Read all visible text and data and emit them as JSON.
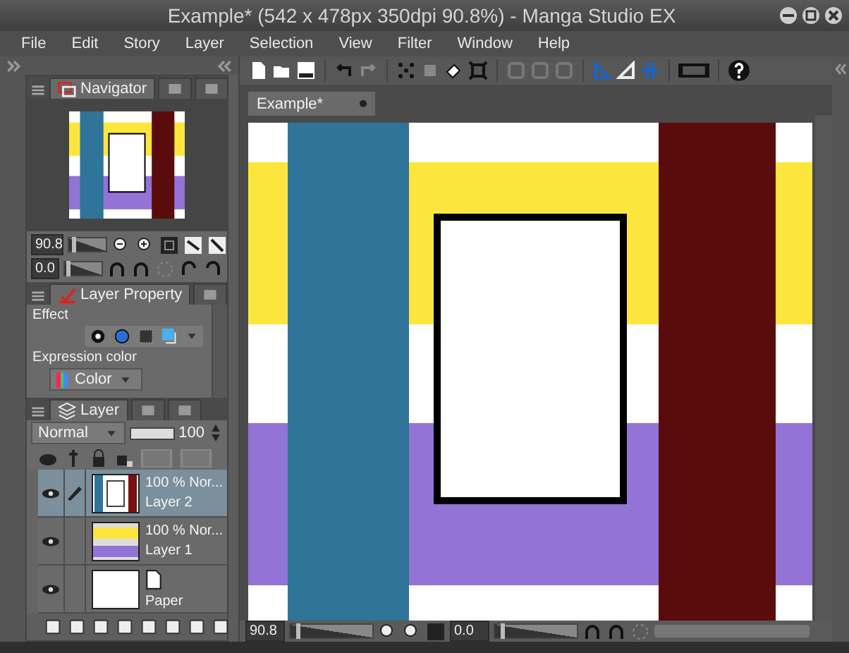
{
  "window": {
    "title": "Example* (542 x 478px 350dpi 90.8%) - Manga Studio EX"
  },
  "menu": [
    "File",
    "Edit",
    "Story",
    "Layer",
    "Selection",
    "View",
    "Filter",
    "Window",
    "Help"
  ],
  "navigator": {
    "tabs": [
      {
        "kind": "text",
        "label": "Navigator",
        "selected": true
      },
      {
        "kind": "icon",
        "selected": false
      },
      {
        "kind": "icon",
        "selected": false
      }
    ],
    "zoom": "90.8",
    "zoom_slider": {
      "level": 0.1
    },
    "angle": "0.0",
    "angle_slider": {
      "level": 0.1
    }
  },
  "layer_property": {
    "tabs": [
      {
        "kind": "text",
        "label": "Layer Property",
        "selected": true
      },
      {
        "kind": "icon",
        "selected": false
      }
    ],
    "effect_label": "Effect",
    "expression_label": "Expression color",
    "expression_value": "Color"
  },
  "layer_panel": {
    "tabs": [
      {
        "kind": "text",
        "label": "Layer",
        "selected": true
      },
      {
        "kind": "icon",
        "selected": false
      },
      {
        "kind": "icon",
        "selected": false
      }
    ],
    "blend_mode": "Normal",
    "opacity_slider": {
      "level": 1
    },
    "opacity": "100",
    "layers": [
      {
        "kind": "raster",
        "name": "Layer 2",
        "info": "100 % Nor...",
        "visible": true,
        "editing": true,
        "selected": true
      },
      {
        "kind": "raster",
        "name": "Layer 1",
        "info": "100 % Nor...",
        "visible": true,
        "editing": false,
        "selected": false
      },
      {
        "kind": "paper",
        "name": "Paper",
        "visible": true,
        "editing": false,
        "selected": false
      }
    ]
  },
  "document": {
    "tab": "Example*"
  },
  "status_bar": {
    "zoom": "90.8",
    "zoom_slider": {
      "level": 0.1
    },
    "angle": "0.0",
    "angle_slider": {
      "level": 0.1
    }
  }
}
